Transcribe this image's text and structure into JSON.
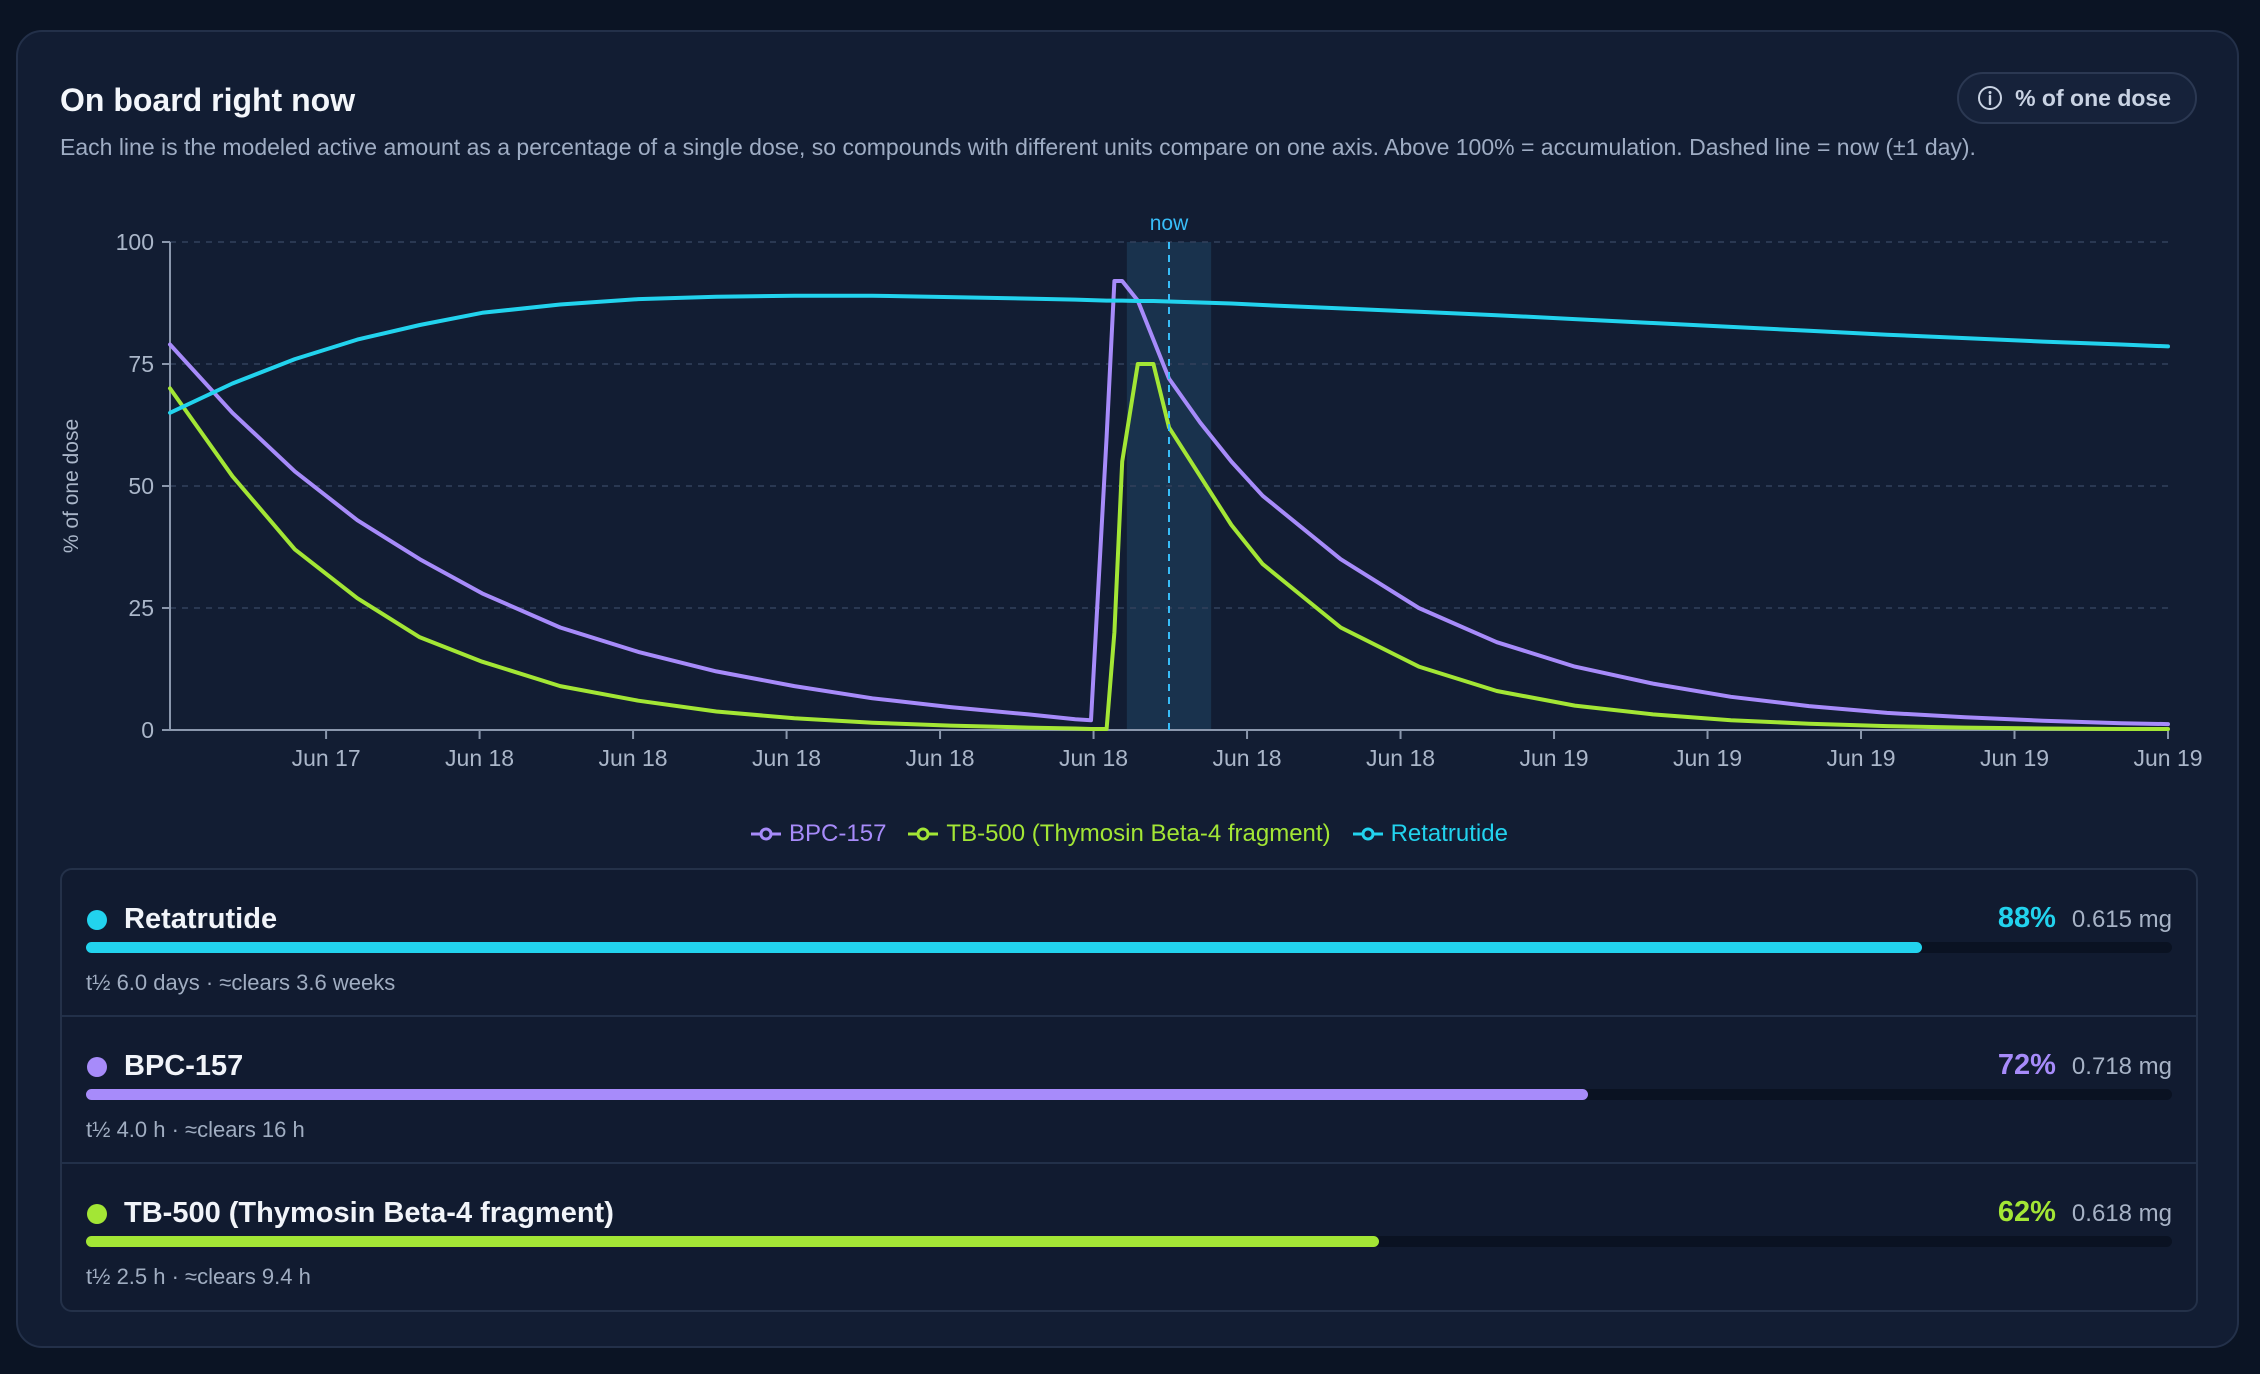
{
  "header": {
    "title": "On board right now",
    "subtitle": "Each line is the modeled active amount as a percentage of a single dose, so compounds with different units compare on one axis. Above 100% = accumulation. Dashed line = now (±1 day).",
    "unit_pill": "% of one dose",
    "unit_pill_icon": "info-icon"
  },
  "chart_data": {
    "type": "line",
    "ylabel": "% of one dose",
    "ylim": [
      0,
      100
    ],
    "yticks": [
      "0",
      "25",
      "50",
      "75",
      "100"
    ],
    "xticks": [
      "Jun 17",
      "Jun 18",
      "Jun 18",
      "Jun 18",
      "Jun 18",
      "Jun 18",
      "Jun 18",
      "Jun 18",
      "Jun 19",
      "Jun 19",
      "Jun 19",
      "Jun 19",
      "Jun 19"
    ],
    "xrange": [
      0,
      12.8
    ],
    "now_label": "now",
    "now_x": 6.4,
    "now_band": [
      6.13,
      6.67
    ],
    "grid": true,
    "legend_placement": "bottom-center",
    "x": [
      0,
      0.4,
      0.8,
      1.2,
      1.6,
      2.0,
      2.5,
      3.0,
      3.5,
      4.0,
      4.5,
      5.0,
      5.5,
      5.8,
      5.9,
      6.0,
      6.05,
      6.1,
      6.2,
      6.3,
      6.4,
      6.6,
      6.8,
      7.0,
      7.5,
      8.0,
      8.5,
      9.0,
      9.5,
      10.0,
      10.5,
      11.0,
      11.5,
      12.0,
      12.5,
      12.8
    ],
    "series": [
      {
        "name": "BPC-157",
        "color": "#a78bfa",
        "values": [
          79,
          65,
          53,
          43,
          35,
          28,
          21,
          16,
          12,
          9,
          6.5,
          4.7,
          3.2,
          2.2,
          2.0,
          60,
          92,
          92,
          88,
          80,
          72,
          63,
          55,
          48,
          35,
          25,
          18,
          13,
          9.5,
          6.8,
          4.9,
          3.5,
          2.6,
          1.9,
          1.4,
          1.2
        ]
      },
      {
        "name": "TB-500 (Thymosin Beta-4 fragment)",
        "color": "#a3e635",
        "values": [
          70,
          52,
          37,
          27,
          19,
          14,
          9,
          6,
          3.8,
          2.4,
          1.5,
          0.9,
          0.5,
          0.3,
          0.2,
          0.2,
          20,
          55,
          75,
          75,
          62,
          52,
          42,
          34,
          21,
          13,
          8,
          5,
          3.2,
          2,
          1.3,
          0.8,
          0.5,
          0.3,
          0.2,
          0.2
        ]
      },
      {
        "name": "Retatrutide",
        "color": "#22d3ee",
        "values": [
          65,
          71,
          76,
          80,
          83,
          85.5,
          87.2,
          88.3,
          88.8,
          89,
          89,
          88.7,
          88.4,
          88.2,
          88.1,
          88.0,
          88.0,
          88.0,
          87.9,
          87.9,
          87.8,
          87.6,
          87.4,
          87.1,
          86.4,
          85.7,
          85,
          84.2,
          83.4,
          82.6,
          81.8,
          81,
          80.3,
          79.6,
          79.0,
          78.6
        ]
      }
    ]
  },
  "doses": [
    {
      "name": "Retatrutide",
      "percent_label": "88%",
      "percent": 88,
      "amount": "0.615 mg",
      "meta": "t½ 6.0 days · ≈clears 3.6 weeks",
      "color": "#22d3ee"
    },
    {
      "name": "BPC-157",
      "percent_label": "72%",
      "percent": 72,
      "amount": "0.718 mg",
      "meta": "t½ 4.0 h · ≈clears 16 h",
      "color": "#a78bfa"
    },
    {
      "name": "TB-500 (Thymosin Beta-4 fragment)",
      "percent_label": "62%",
      "percent": 62,
      "amount": "0.618 mg",
      "meta": "t½ 2.5 h · ≈clears 9.4 h",
      "color": "#a3e635"
    }
  ]
}
